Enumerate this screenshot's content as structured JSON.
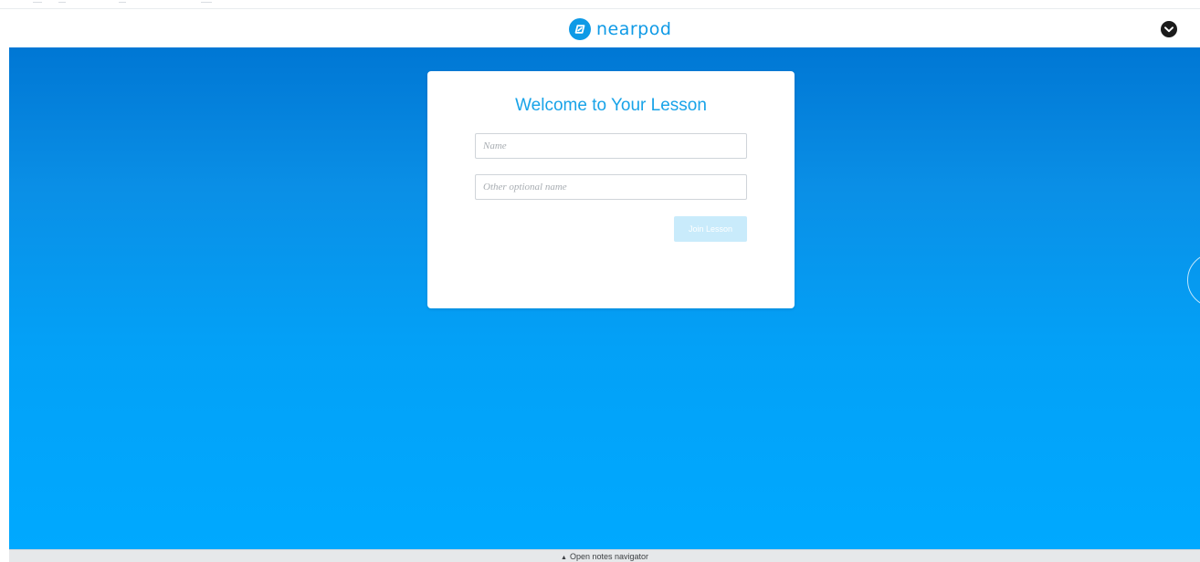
{
  "header": {
    "logo_text": "nearpod",
    "logo_icon": "nearpod-logo-icon",
    "menu_icon": "chevron-down-circle-icon"
  },
  "login_card": {
    "title": "Welcome to Your Lesson",
    "name_field": {
      "value": "",
      "placeholder": "Name"
    },
    "other_name_field": {
      "value": "",
      "placeholder": "Other optional name"
    },
    "join_button_label": "Join Lesson"
  },
  "footer": {
    "arrow_icon": "▲",
    "notes_navigator_label": "Open notes navigator"
  },
  "colors": {
    "brand_blue": "#0f9ae6",
    "title_blue": "#18a3e8",
    "button_disabled": "#c9ebfb",
    "background_top": "#0077d4",
    "background_bottom": "#00a9ff"
  }
}
